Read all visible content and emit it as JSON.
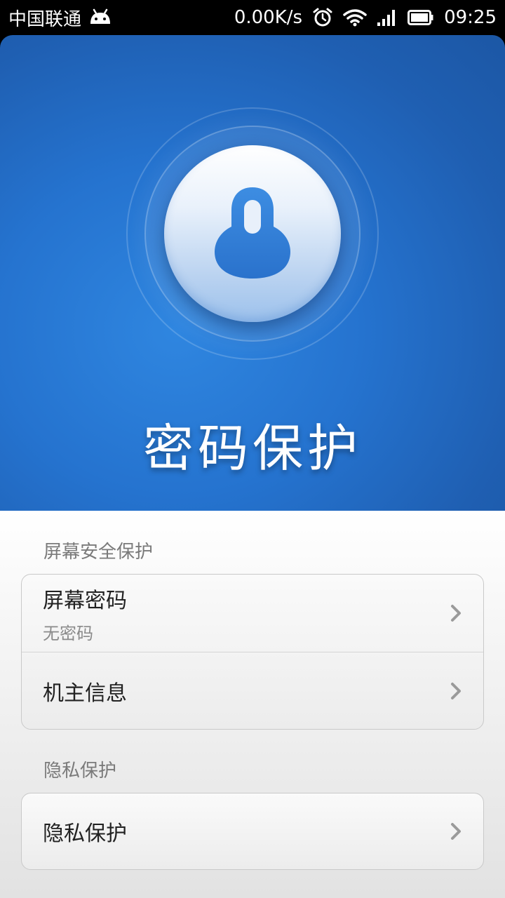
{
  "status_bar": {
    "carrier": "中国联通",
    "speed": "0.00K/s",
    "time": "09:25",
    "icons": [
      "android-icon",
      "alarm-icon",
      "wifi-icon",
      "signal-icon",
      "battery-icon"
    ]
  },
  "hero": {
    "title": "密码保护",
    "icon": "lock-icon"
  },
  "sections": [
    {
      "header": "屏幕安全保护",
      "items": [
        {
          "title": "屏幕密码",
          "subtitle": "无密码"
        },
        {
          "title": "机主信息"
        }
      ]
    },
    {
      "header": "隐私保护",
      "items": [
        {
          "title": "隐私保护"
        }
      ]
    }
  ],
  "colors": {
    "hero_blue": "#2573cf",
    "lock_blue": "#2f7fdc",
    "chevron": "#9a9a9a"
  }
}
